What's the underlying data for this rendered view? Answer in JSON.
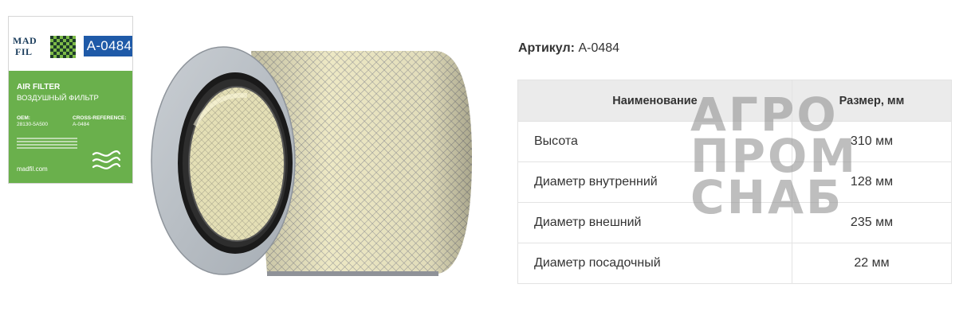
{
  "package": {
    "brand_line1": "MAD",
    "brand_line2": "FIL",
    "code": "A-0484",
    "title_en": "AIR FILTER",
    "title_ru": "ВОЗДУШНЫЙ ФИЛЬТР",
    "oem_label": "OEM:",
    "oem_value": "28130-5A500",
    "cross_label": "CROSS-REFERENCE:",
    "cross_value": "A-0484",
    "url": "madfil.com",
    "colors": {
      "green": "#6ab04c",
      "blue": "#1f5aa8",
      "navy": "#1b3d5c"
    }
  },
  "product": {
    "article_label": "Артикул:",
    "article_value": "A-0484"
  },
  "table": {
    "headers": [
      "Наименование",
      "Размер, мм"
    ],
    "rows": [
      {
        "name": "Высота",
        "value": "310 мм"
      },
      {
        "name": "Диаметр внутренний",
        "value": "128 мм"
      },
      {
        "name": "Диаметр внешний",
        "value": "235 мм"
      },
      {
        "name": "Диаметр посадочный",
        "value": "22 мм"
      }
    ]
  },
  "watermark": {
    "line1": "АГРО",
    "line2": "ПРОМ",
    "line3": "СНАБ"
  }
}
